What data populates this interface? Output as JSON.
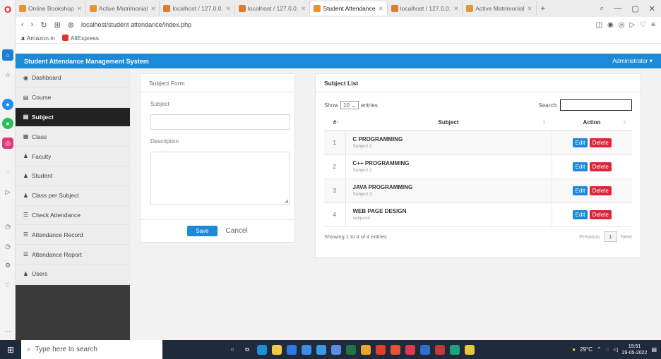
{
  "browser": {
    "tabs": [
      {
        "label": "Online Bookshop",
        "fav": "o",
        "active": false
      },
      {
        "label": "Active Matrimonial",
        "fav": "o",
        "active": false
      },
      {
        "label": "localhost / 127.0.0.",
        "fav": "p",
        "active": false
      },
      {
        "label": "localhost / 127.0.0.",
        "fav": "p",
        "active": false
      },
      {
        "label": "Student Attendance",
        "fav": "o",
        "active": true
      },
      {
        "label": "localhost / 127.0.0.",
        "fav": "p",
        "active": false
      },
      {
        "label": "Active Matrimonial",
        "fav": "o",
        "active": false
      }
    ],
    "address": "localhost/student attendance/index.php",
    "bookmarks": [
      "Amazon.in",
      "AliExpress"
    ]
  },
  "app": {
    "title": "Student Attendance Management System",
    "user": "Administrator"
  },
  "sidebar": {
    "items": [
      {
        "label": "Dashboard",
        "icon": "dashboard-icon",
        "glyph": "◉"
      },
      {
        "label": "Course",
        "icon": "list-icon",
        "glyph": "▤"
      },
      {
        "label": "Subject",
        "icon": "list-icon",
        "glyph": "▤"
      },
      {
        "label": "Class",
        "icon": "table-icon",
        "glyph": "▦"
      },
      {
        "label": "Faculty",
        "icon": "user-icon",
        "glyph": "♟"
      },
      {
        "label": "Student",
        "icon": "users-icon",
        "glyph": "♟"
      },
      {
        "label": "Class per Subject",
        "icon": "users-icon",
        "glyph": "♟"
      },
      {
        "label": "Check Attendance",
        "icon": "list-icon",
        "glyph": "☰"
      },
      {
        "label": "Attendance Record",
        "icon": "list-icon",
        "glyph": "☰"
      },
      {
        "label": "Attendance Report",
        "icon": "list-icon",
        "glyph": "☰"
      },
      {
        "label": "Users",
        "icon": "users-icon",
        "glyph": "♟"
      }
    ],
    "active_index": 2
  },
  "form": {
    "title": "Subject Form",
    "subject_label": "Subject",
    "description_label": "Description",
    "save_label": "Save",
    "cancel_label": "Cancel"
  },
  "list": {
    "title": "Subject List",
    "show_label": "Show",
    "length_value": "10",
    "entries_label": "entries",
    "search_label": "Search:",
    "columns": [
      "#",
      "Subject",
      "Action"
    ],
    "rows": [
      {
        "num": "1",
        "name": "C PROGRAMMING",
        "desc": "Subject 1"
      },
      {
        "num": "2",
        "name": "C++ PROGRAMMING",
        "desc": "Subject 2"
      },
      {
        "num": "3",
        "name": "JAVA PROGRAMMING",
        "desc": "Subject 3"
      },
      {
        "num": "4",
        "name": "WEB PAGE DESIGN",
        "desc": "subject4"
      }
    ],
    "edit_label": "Edit",
    "delete_label": "Delete",
    "info": "Showing 1 to 4 of 4 entries",
    "prev_label": "Previous",
    "page": "1",
    "next_label": "Next"
  },
  "taskbar": {
    "search_placeholder": "Type here to search",
    "temperature": "29°C",
    "time": "19:51",
    "date": "29-05-2022"
  },
  "colors": {
    "primary": "#1b8ad9",
    "danger": "#e0253a",
    "sidebar_active": "#222222"
  }
}
